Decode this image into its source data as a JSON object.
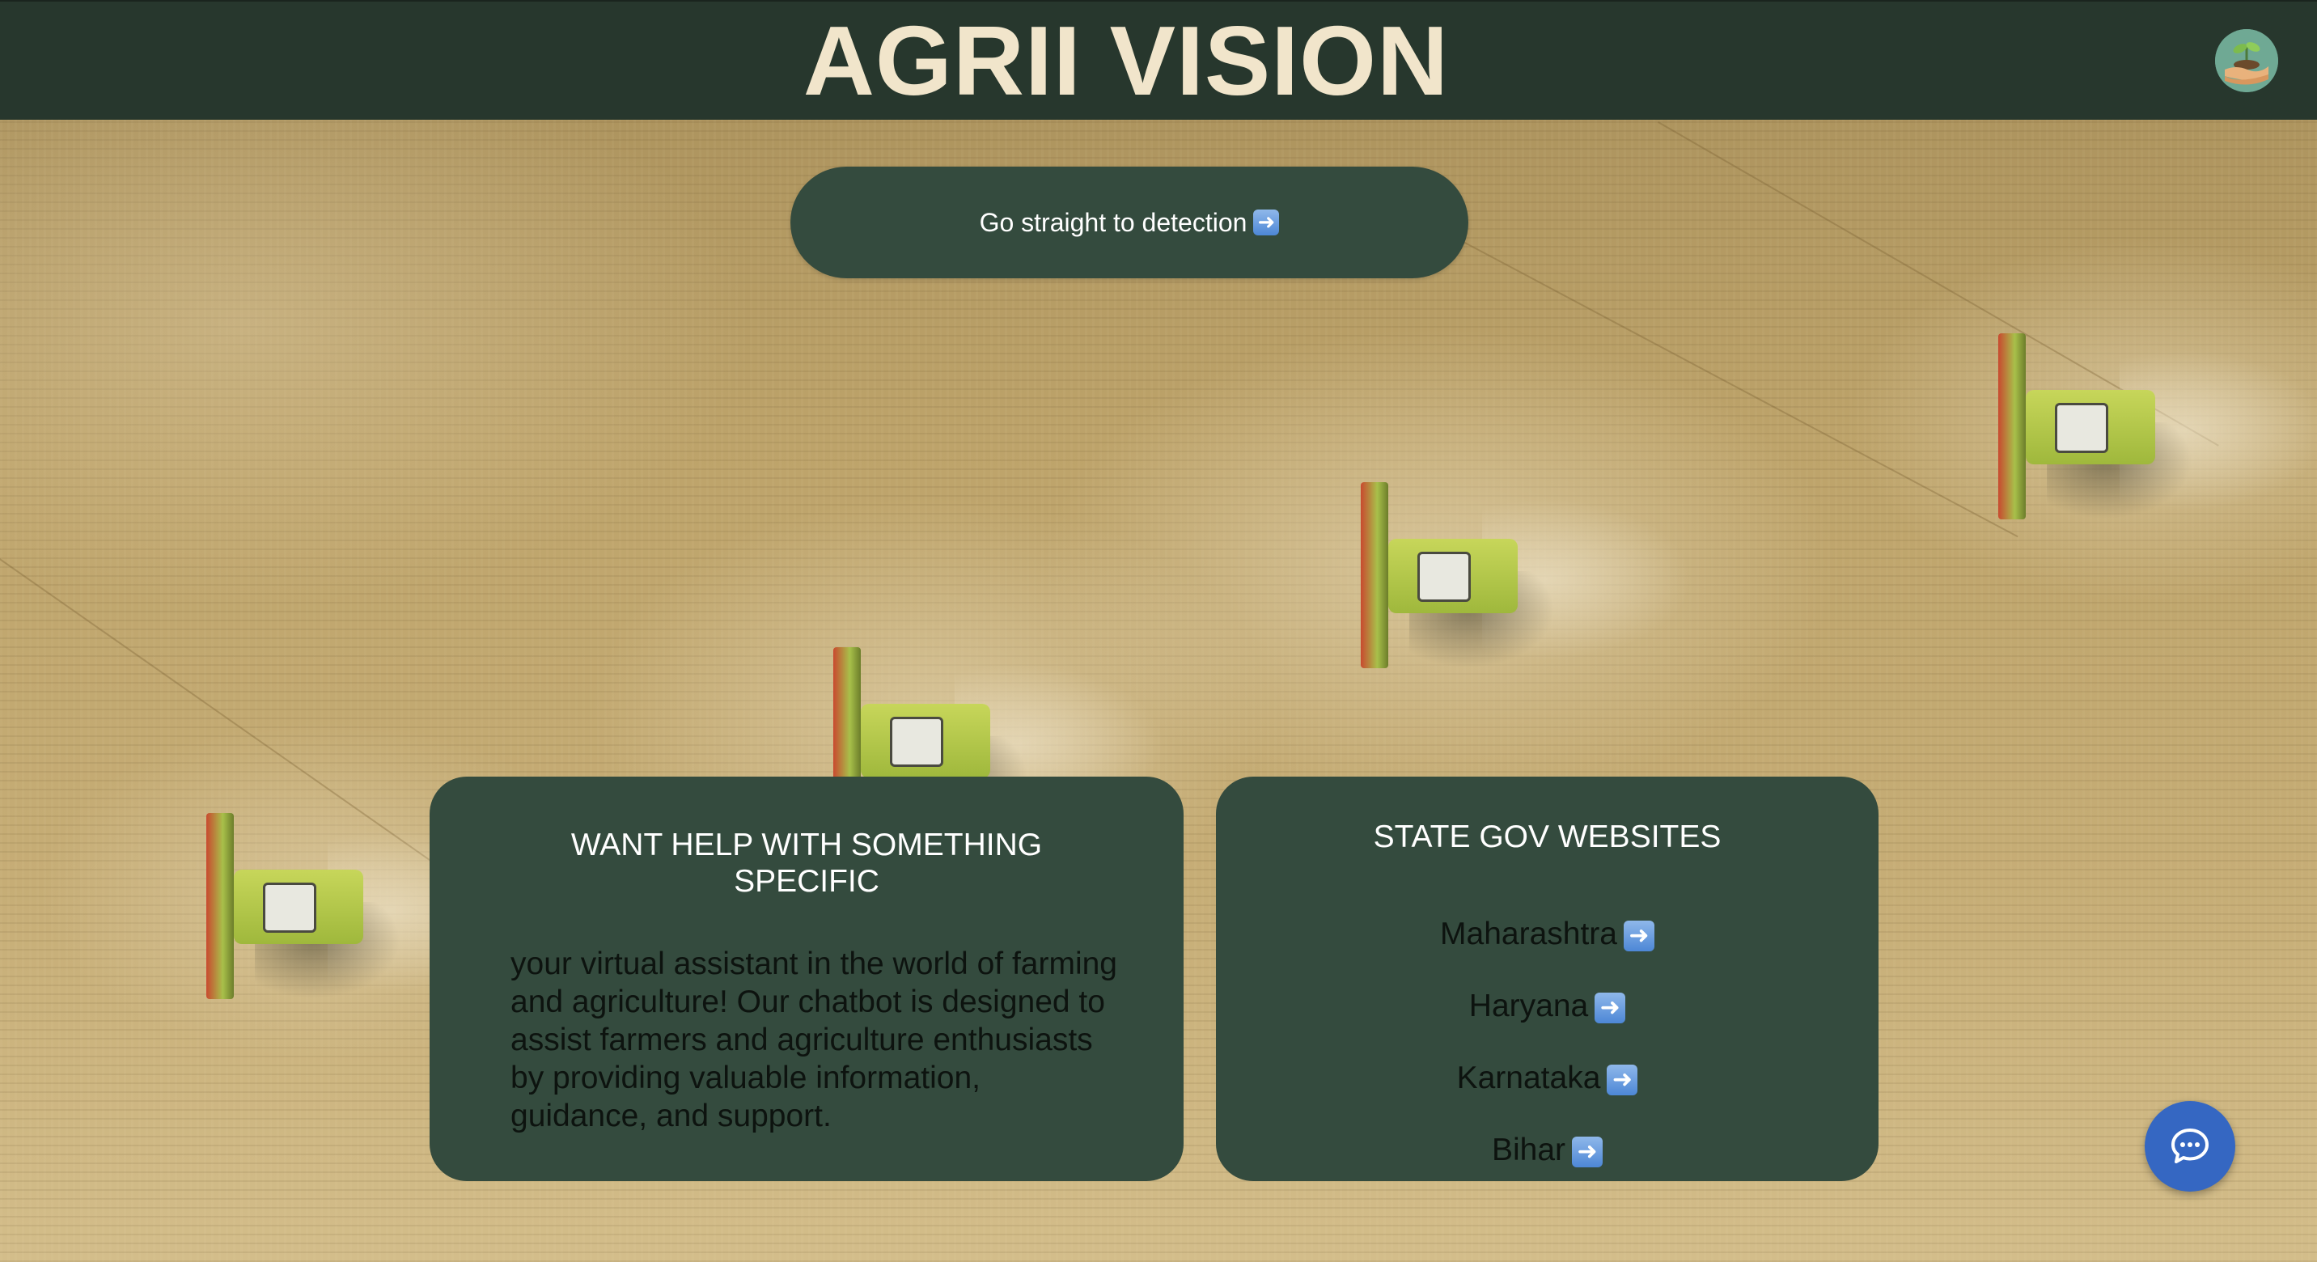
{
  "header": {
    "title": "AGRII VISION",
    "logo_icon": "plant-in-hand-icon"
  },
  "hero": {
    "detect_button_label": "Go straight to detection",
    "arrow_icon": "right-arrow-icon"
  },
  "help_card": {
    "title": "WANT HELP WITH SOMETHING SPECIFIC",
    "body": "your virtual assistant in the world of farming and agriculture! Our chatbot is designed to assist farmers and agriculture enthusiasts by providing valuable information, guidance, and support."
  },
  "gov_card": {
    "title": "STATE GOV WEBSITES",
    "states": [
      {
        "label": "Maharashtra"
      },
      {
        "label": "Haryana"
      },
      {
        "label": "Karnataka"
      },
      {
        "label": "Bihar"
      }
    ]
  },
  "chat": {
    "icon": "chat-bubble-icon"
  },
  "colors": {
    "header_bg": "#27372d",
    "title_color": "#f1e5cb",
    "card_bg": "#344b3e",
    "chat_fab": "#3567c2"
  }
}
